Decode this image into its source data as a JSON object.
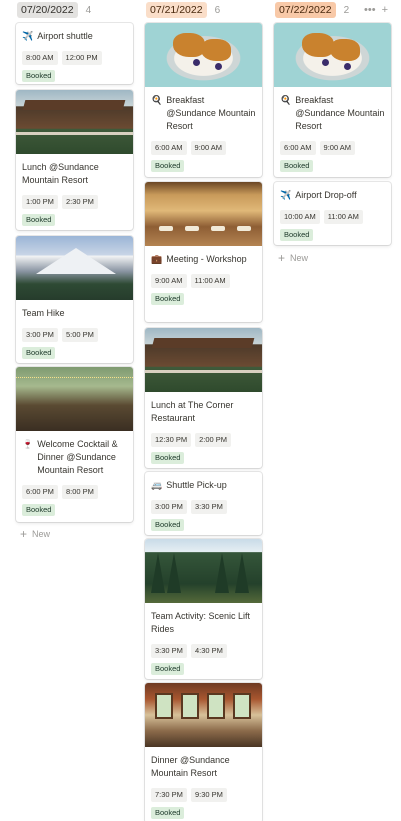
{
  "columns": [
    {
      "date": "07/20/2022",
      "count": "4",
      "cards": [
        {
          "emoji": "✈️",
          "title": "Airport shuttle",
          "start": "8:00 AM",
          "end": "12:00 PM",
          "status": "Booked"
        },
        {
          "emoji": "",
          "title": "Lunch @Sundance Mountain Resort",
          "start": "1:00 PM",
          "end": "2:30 PM",
          "status": "Booked"
        },
        {
          "emoji": "",
          "title": "Team Hike",
          "start": "3:00 PM",
          "end": "5:00 PM",
          "status": "Booked"
        },
        {
          "emoji": "🍷",
          "title": "Welcome Cocktail & Dinner @Sundance Mountain Resort",
          "start": "6:00 PM",
          "end": "8:00 PM",
          "status": "Booked"
        }
      ],
      "new_label": "New"
    },
    {
      "date": "07/21/2022",
      "count": "6",
      "cards": [
        {
          "emoji": "🍳",
          "title": "Breakfast @Sundance Mountain Resort",
          "start": "6:00 AM",
          "end": "9:00 AM",
          "status": "Booked"
        },
        {
          "emoji": "💼",
          "title": "Meeting - Workshop",
          "start": "9:00 AM",
          "end": "11:00 AM",
          "status": "Booked"
        },
        {
          "emoji": "",
          "title": "Lunch at The Corner Restaurant",
          "start": "12:30 PM",
          "end": "2:00 PM",
          "status": "Booked"
        },
        {
          "emoji": "🚐",
          "title": "Shuttle Pick-up",
          "start": "3:00 PM",
          "end": "3:30 PM",
          "status": "Booked"
        },
        {
          "emoji": "",
          "title": "Team Activity: Scenic Lift Rides",
          "start": "3:30 PM",
          "end": "4:30 PM",
          "status": "Booked"
        },
        {
          "emoji": "",
          "title": "Dinner @Sundance Mountain Resort",
          "start": "7:30 PM",
          "end": "9:30 PM",
          "status": "Booked"
        }
      ]
    },
    {
      "date": "07/22/2022",
      "count": "2",
      "cards": [
        {
          "emoji": "🍳",
          "title": "Breakfast @Sundance Mountain Resort",
          "start": "6:00 AM",
          "end": "9:00 AM",
          "status": "Booked"
        },
        {
          "emoji": "✈️",
          "title": "Airport Drop-off",
          "start": "10:00 AM",
          "end": "11:00 AM",
          "status": "Booked"
        }
      ],
      "new_label": "New",
      "actions": {
        "more": "•••",
        "add": "+"
      }
    }
  ],
  "colors": {
    "booked_bg": "#dbeddb",
    "booked_text": "#1c3829",
    "tag_gray": "#e3e2e0",
    "tag_peach": "#fadec9",
    "tag_orange": "#f8c9a8"
  }
}
